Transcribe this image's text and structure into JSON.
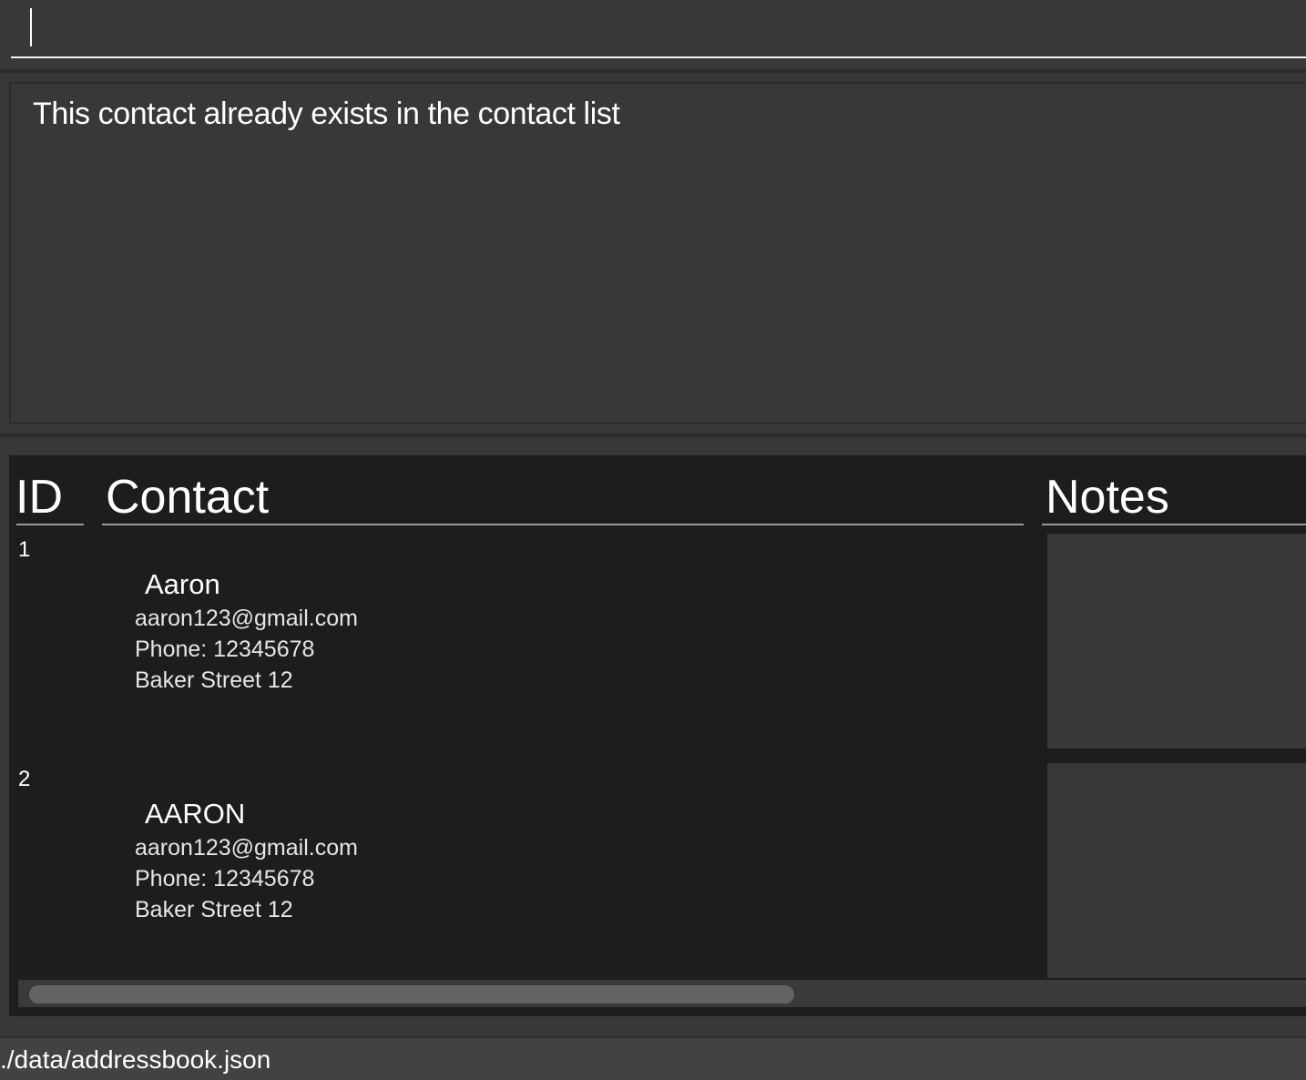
{
  "command_box": {
    "value": "",
    "placeholder": ""
  },
  "result_display": {
    "message": "This contact already exists in the contact list"
  },
  "contact_list": {
    "headers": {
      "id": "ID",
      "contact": "Contact",
      "notes": "Notes"
    },
    "rows": [
      {
        "id": "1",
        "name": "Aaron",
        "email": "aaron123@gmail.com",
        "phone": "Phone: 12345678",
        "address": "Baker Street 12",
        "notes": ""
      },
      {
        "id": "2",
        "name": "AARON",
        "email": "aaron123@gmail.com",
        "phone": "Phone: 12345678",
        "address": "Baker Street 12",
        "notes": ""
      }
    ]
  },
  "status_bar": {
    "file_path": "./data/addressbook.json"
  },
  "colors": {
    "app_background": "#383838",
    "list_background": "#1d1d1d",
    "notes_background": "#383838",
    "text": "#ffffff",
    "underline": "#9a9a9a"
  }
}
